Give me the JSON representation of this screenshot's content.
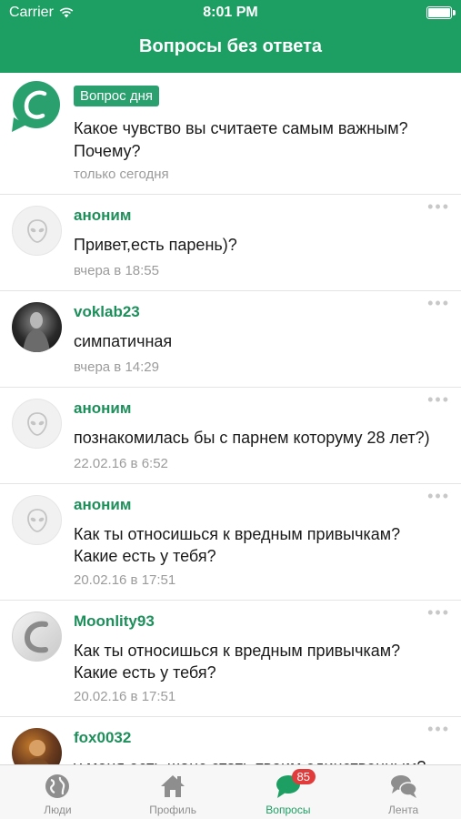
{
  "status_bar": {
    "carrier": "Carrier",
    "time": "8:01 PM"
  },
  "header": {
    "title": "Вопросы без ответа"
  },
  "question_of_day": {
    "badge": "Вопрос дня",
    "line1": "Какое чувство вы считаете самым важным?",
    "line2": "Почему?",
    "meta": "только сегодня"
  },
  "items": [
    {
      "author": "аноним",
      "line1": "Привет,есть парень)?",
      "line2": "",
      "meta": "вчера в 18:55",
      "avatar": "alien-icon"
    },
    {
      "author": "voklab23",
      "line1": "симпатичная",
      "line2": "",
      "meta": "вчера в 14:29",
      "avatar": "user-photo"
    },
    {
      "author": "аноним",
      "line1": "познакомилась бы с парнем которуму 28 лет?)",
      "line2": "",
      "meta": "22.02.16 в 6:52",
      "avatar": "alien-icon"
    },
    {
      "author": "аноним",
      "line1": "Как ты относишься к вредным привычкам?",
      "line2": "Какие есть у тебя?",
      "meta": "20.02.16 в 17:51",
      "avatar": "alien-icon"
    },
    {
      "author": "Moonlity93",
      "line1": "Как ты относишься к вредным привычкам?",
      "line2": "Какие есть у тебя?",
      "meta": "20.02.16 в 17:51",
      "avatar": "moon-logo"
    },
    {
      "author": "fox0032",
      "line1": "у меня есть шанс стать твоим единственным?",
      "line2": "",
      "meta": "",
      "avatar": "user-photo"
    }
  ],
  "more_label": "•••",
  "tabs": [
    {
      "label": "Люди",
      "icon": "globe-icon"
    },
    {
      "label": "Профиль",
      "icon": "home-icon"
    },
    {
      "label": "Вопросы",
      "icon": "chat-bubble-icon",
      "badge": "85"
    },
    {
      "label": "Лента",
      "icon": "chat-bubbles-icon"
    }
  ],
  "colors": {
    "brand": "#1d9f63",
    "badge": "#e23b3b"
  }
}
